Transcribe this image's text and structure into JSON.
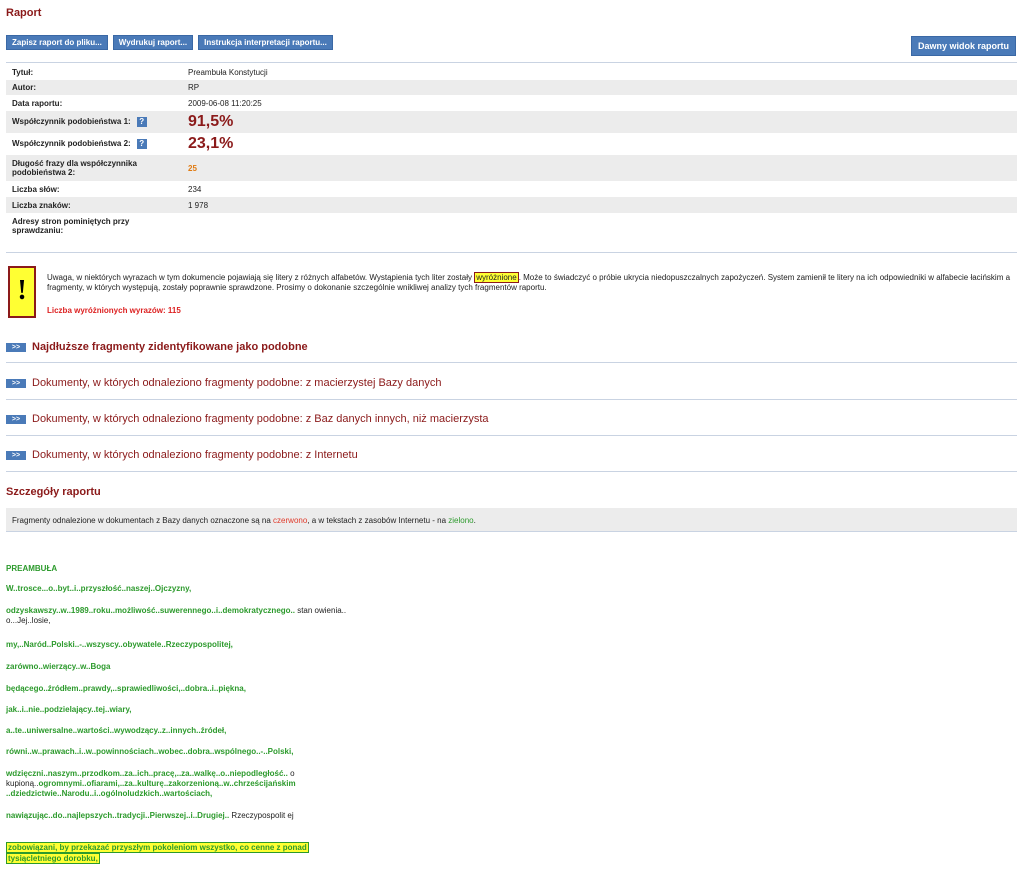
{
  "title": "Raport",
  "toolbar": {
    "save": "Zapisz raport do pliku...",
    "print": "Wydrukuj raport...",
    "instructions": "Instrukcja interpretacji raportu...",
    "old_view": "Dawny widok raportu"
  },
  "meta": {
    "title_label": "Tytuł:",
    "title_value": "Preambuła Konstytucji",
    "author_label": "Autor:",
    "author_value": "RP",
    "date_label": "Data raportu:",
    "date_value": "2009-06-08 11:20:25",
    "coef1_label": "Współczynnik podobieństwa 1:",
    "coef1_value": "91,5%",
    "coef2_label": "Współczynnik podobieństwa 2:",
    "coef2_value": "23,1%",
    "phrase_label": "Długość frazy dla współczynnika podobieństwa 2:",
    "phrase_value": "25",
    "words_label": "Liczba słów:",
    "words_value": "234",
    "chars_label": "Liczba znaków:",
    "chars_value": "1 978",
    "skipped_label": "Adresy stron pominiętych przy sprawdzaniu:",
    "skipped_value": "",
    "help_icon": "?"
  },
  "warning": {
    "icon": "!",
    "text_before": "Uwaga, w niektórych wyrazach w tym dokumencie pojawiają się litery z różnych alfabetów. Wystąpienia tych liter zostały ",
    "highlight": "wyróżnione",
    "text_after": ". Może to świadczyć o próbie ukrycia niedopuszczalnych zapożyczeń. System zamienił te litery na ich odpowiedniki w alfabecie łacińskim a fragmenty, w których występują, zostały poprawnie sprawdzone. Prosimy o dokonanie szczególnie wnikliwej analizy tych fragmentów raportu.",
    "count": "Liczba wyróżnionych wyrazów: 115"
  },
  "sections": {
    "button": ">>",
    "s1": "Najdłuższe fragmenty zidentyfikowane jako podobne",
    "s2": "Dokumenty, w których odnaleziono fragmenty podobne: z macierzystej Bazy danych",
    "s3": "Dokumenty, w których odnaleziono fragmenty podobne: z Baz danych innych, niż macierzysta",
    "s4": "Dokumenty, w których odnaleziono fragmenty podobne: z Internetu"
  },
  "details": {
    "heading": "Szczegóły raportu",
    "legend_before": "Fragmenty odnalezione w dokumentach z Bazy danych oznaczone są na ",
    "legend_red": "czerwono",
    "legend_mid": ", a w tekstach z zasobów Internetu - na ",
    "legend_green": "zielono",
    "legend_end": "."
  },
  "fragments": {
    "f0": "PREAMBUŁA",
    "f1": "W..trosce...o..byt..i..przyszłość..naszej..Ojczyzny,",
    "f2a": "odzyskawszy..w..1989..roku..możliwość..suwerennego..i..demokratycznego..",
    "f2b": " stan owienia.. o...Jej..losie,",
    "f3": "my,..Naród..Polski..-..wszyscy..obywatele..Rzeczypospolitej,",
    "f4": "zarówno..wierzący..w..Boga",
    "f5": "będącego..źródłem..prawdy,..sprawiedliwości,..dobra..i..piękna,",
    "f6": "jak..i..nie..podzielający..tej..wiary,",
    "f7": "a..te..uniwersalne..wartości..wywodzący..z..innych..źródeł,",
    "f8": "równi..w..prawach..i..w..powinnościach..wobec..dobra..wspólnego..-..Polski,",
    "f9a": "wdzięczni..naszym..przodkom..za..ich..pracę,..za..walkę..o..niepodległość..",
    "f9b": " o kupioną..",
    "f9c": "ogromnymi..ofiarami,..za..kulturę..zakorzenioną..w..chrześcijańskim ..dziedzictwie..Narodu..i..ogólnoludzkich..wartościach,",
    "f10a": "nawiązując..do..najlepszych..tradycji..Pierwszej..i..Drugiej..",
    "f10b": " Rzeczypospolit ej",
    "f11_1": "zobowiązani, by przekazać przyszłym pokoleniom wszystko, co cenne z ponad",
    "f11_2": "tysiącletniego dorobku,"
  }
}
